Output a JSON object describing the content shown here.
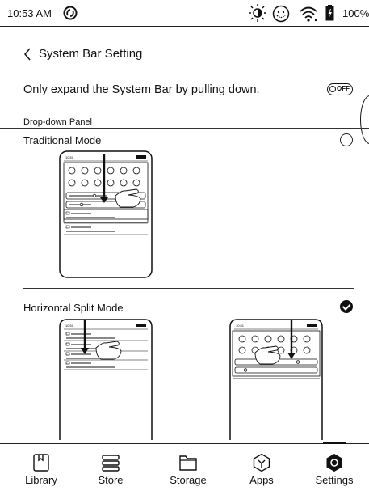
{
  "status_bar": {
    "time": "10:53 AM",
    "battery": "100%",
    "icons": [
      "nfc-icon",
      "brightness-icon",
      "emoji-icon",
      "wifi-icon",
      "battery-icon"
    ]
  },
  "header": {
    "title": "System Bar Setting",
    "back_icon": "chevron-left-icon"
  },
  "expand_setting": {
    "label": "Only expand the System Bar by pulling down.",
    "toggle_text": "OFF",
    "toggle_state": "off"
  },
  "section": {
    "label": "Drop-down Panel"
  },
  "modes": [
    {
      "label": "Traditional Mode",
      "selected": false
    },
    {
      "label": "Horizontal Split Mode",
      "selected": true
    }
  ],
  "bottom_nav": {
    "items": [
      {
        "label": "Library",
        "icon": "library-icon"
      },
      {
        "label": "Store",
        "icon": "store-icon"
      },
      {
        "label": "Storage",
        "icon": "folder-icon"
      },
      {
        "label": "Apps",
        "icon": "apps-icon"
      },
      {
        "label": "Settings",
        "icon": "settings-icon",
        "active": true
      }
    ]
  }
}
